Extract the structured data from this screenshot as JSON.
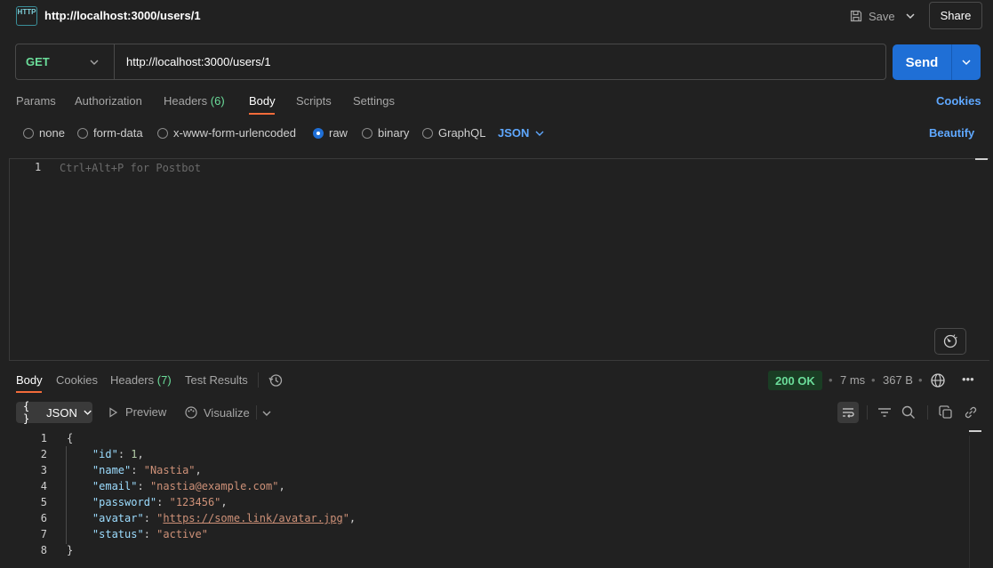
{
  "header": {
    "http_badge": "HTTP",
    "tab_title": "http://localhost:3000/users/1",
    "save_label": "Save",
    "share_label": "Share"
  },
  "request": {
    "method": "GET",
    "url": "http://localhost:3000/users/1",
    "send_label": "Send",
    "tabs": [
      {
        "label": "Params"
      },
      {
        "label": "Authorization"
      },
      {
        "label": "Headers",
        "count": "(6)"
      },
      {
        "label": "Body",
        "active": true
      },
      {
        "label": "Scripts"
      },
      {
        "label": "Settings"
      }
    ],
    "cookies_label": "Cookies",
    "body_types": [
      {
        "label": "none"
      },
      {
        "label": "form-data"
      },
      {
        "label": "x-www-form-urlencoded"
      },
      {
        "label": "raw",
        "checked": true
      },
      {
        "label": "binary"
      },
      {
        "label": "GraphQL"
      }
    ],
    "body_format": "JSON",
    "beautify_label": "Beautify",
    "editor": {
      "line": "1",
      "placeholder": "Ctrl+Alt+P for Postbot"
    }
  },
  "response": {
    "tabs": [
      {
        "label": "Body",
        "active": true
      },
      {
        "label": "Cookies"
      },
      {
        "label": "Headers",
        "count": "(7)"
      },
      {
        "label": "Test Results"
      }
    ],
    "status": "200 OK",
    "time": "7 ms",
    "size": "367 B",
    "format": "JSON",
    "preview_label": "Preview",
    "visualize_label": "Visualize",
    "body_lines": [
      {
        "n": "1",
        "tokens": [
          {
            "t": "{",
            "c": ""
          }
        ]
      },
      {
        "n": "2",
        "tokens": [
          {
            "t": "    ",
            "c": ""
          },
          {
            "t": "\"id\"",
            "c": "k"
          },
          {
            "t": ": ",
            "c": ""
          },
          {
            "t": "1",
            "c": "n"
          },
          {
            "t": ",",
            "c": ""
          }
        ]
      },
      {
        "n": "3",
        "tokens": [
          {
            "t": "    ",
            "c": ""
          },
          {
            "t": "\"name\"",
            "c": "k"
          },
          {
            "t": ": ",
            "c": ""
          },
          {
            "t": "\"Nastia\"",
            "c": "s"
          },
          {
            "t": ",",
            "c": ""
          }
        ]
      },
      {
        "n": "4",
        "tokens": [
          {
            "t": "    ",
            "c": ""
          },
          {
            "t": "\"email\"",
            "c": "k"
          },
          {
            "t": ": ",
            "c": ""
          },
          {
            "t": "\"nastia@example.com\"",
            "c": "s"
          },
          {
            "t": ",",
            "c": ""
          }
        ]
      },
      {
        "n": "5",
        "tokens": [
          {
            "t": "    ",
            "c": ""
          },
          {
            "t": "\"password\"",
            "c": "k"
          },
          {
            "t": ": ",
            "c": ""
          },
          {
            "t": "\"123456\"",
            "c": "s"
          },
          {
            "t": ",",
            "c": ""
          }
        ]
      },
      {
        "n": "6",
        "tokens": [
          {
            "t": "    ",
            "c": ""
          },
          {
            "t": "\"avatar\"",
            "c": "k"
          },
          {
            "t": ": ",
            "c": ""
          },
          {
            "t": "\"",
            "c": "s"
          },
          {
            "t": "https://some.link/avatar.jpg",
            "c": "u"
          },
          {
            "t": "\"",
            "c": "s"
          },
          {
            "t": ",",
            "c": ""
          }
        ]
      },
      {
        "n": "7",
        "tokens": [
          {
            "t": "    ",
            "c": ""
          },
          {
            "t": "\"status\"",
            "c": "k"
          },
          {
            "t": ": ",
            "c": ""
          },
          {
            "t": "\"active\"",
            "c": "s"
          }
        ]
      },
      {
        "n": "8",
        "tokens": [
          {
            "t": "}",
            "c": ""
          }
        ]
      }
    ]
  },
  "colors": {
    "accent_blue": "#1f6fd6",
    "method_green": "#6bdd9a",
    "tab_underline": "#f26b3a",
    "link_blue": "#5fa8ff"
  },
  "icons": [
    "http-icon",
    "save-icon",
    "chevron-down-icon",
    "history-icon",
    "globe-icon",
    "more-icon",
    "play-icon",
    "visualize-icon",
    "wrap-icon",
    "filter-icon",
    "search-icon",
    "copy-icon",
    "link-icon",
    "postbot-icon"
  ]
}
